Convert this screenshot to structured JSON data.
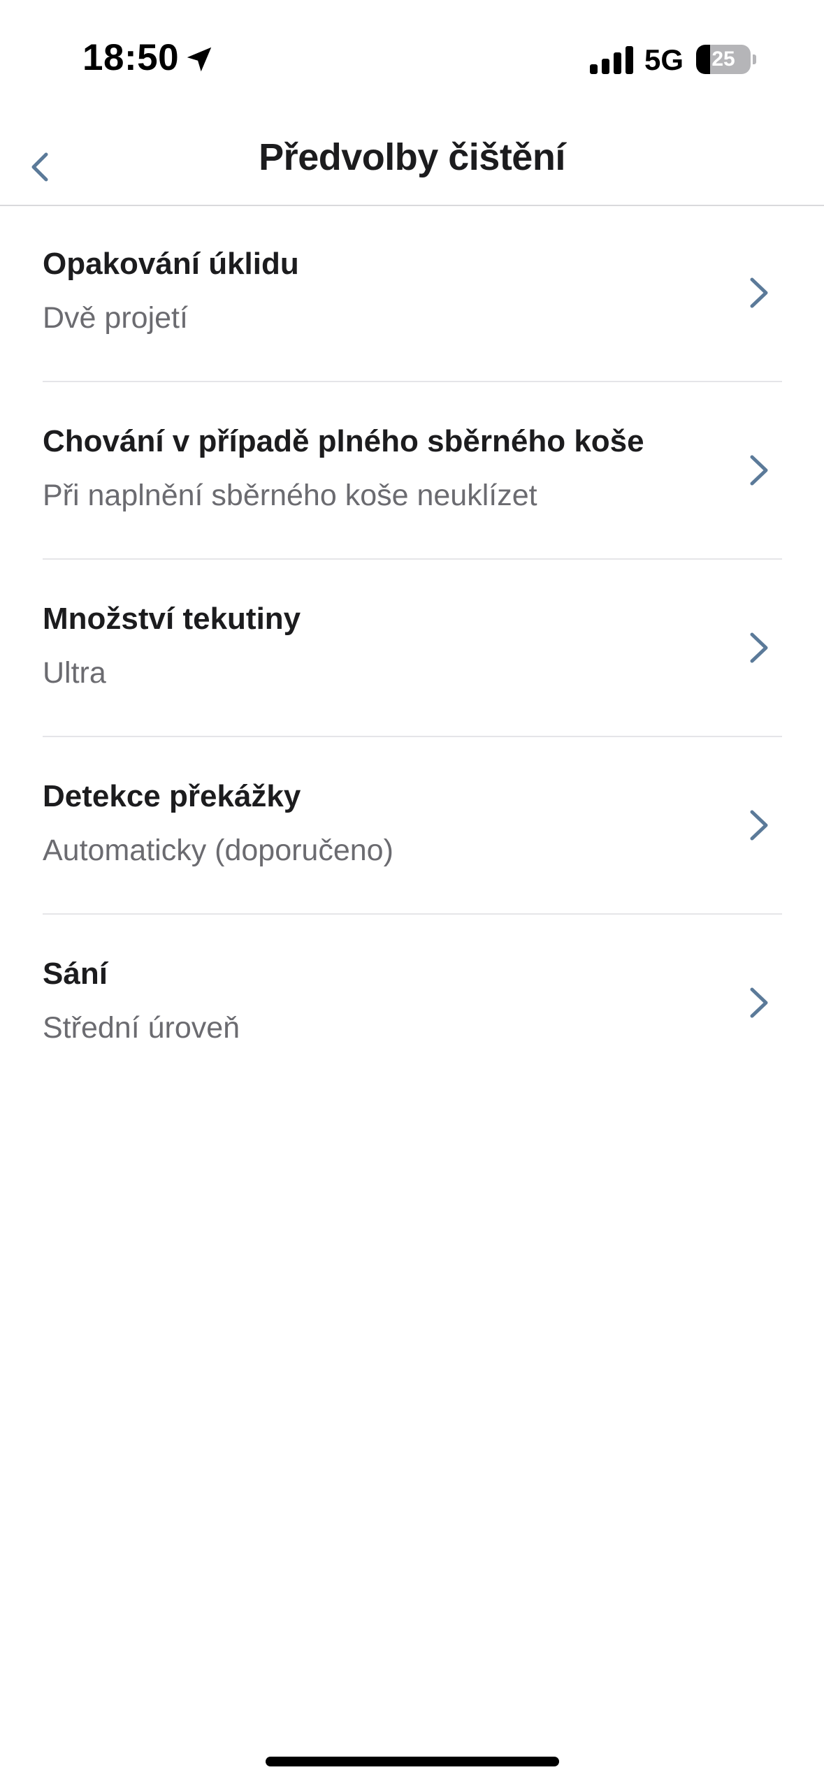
{
  "status_bar": {
    "time": "18:50",
    "network": "5G",
    "battery_level": "25",
    "battery_fraction": 0.25,
    "icons": [
      "location-arrow-icon",
      "cellular-signal-icon",
      "battery-icon"
    ]
  },
  "nav": {
    "title": "Předvolby čištění",
    "back_icon": "chevron-left-icon"
  },
  "colors": {
    "accent": "#5b7a99",
    "title_text": "#1c1c1e",
    "subtitle_text": "#6b6b70",
    "divider": "#e5e5e8"
  },
  "settings": [
    {
      "title": "Opakování úklidu",
      "value": "Dvě projetí"
    },
    {
      "title": "Chování v případě plného sběrného koše",
      "value": "Při naplnění sběrného koše neuklízet"
    },
    {
      "title": "Množství tekutiny",
      "value": "Ultra"
    },
    {
      "title": "Detekce překážky",
      "value": "Automaticky (doporučeno)"
    },
    {
      "title": "Sání",
      "value": "Střední úroveň"
    }
  ]
}
